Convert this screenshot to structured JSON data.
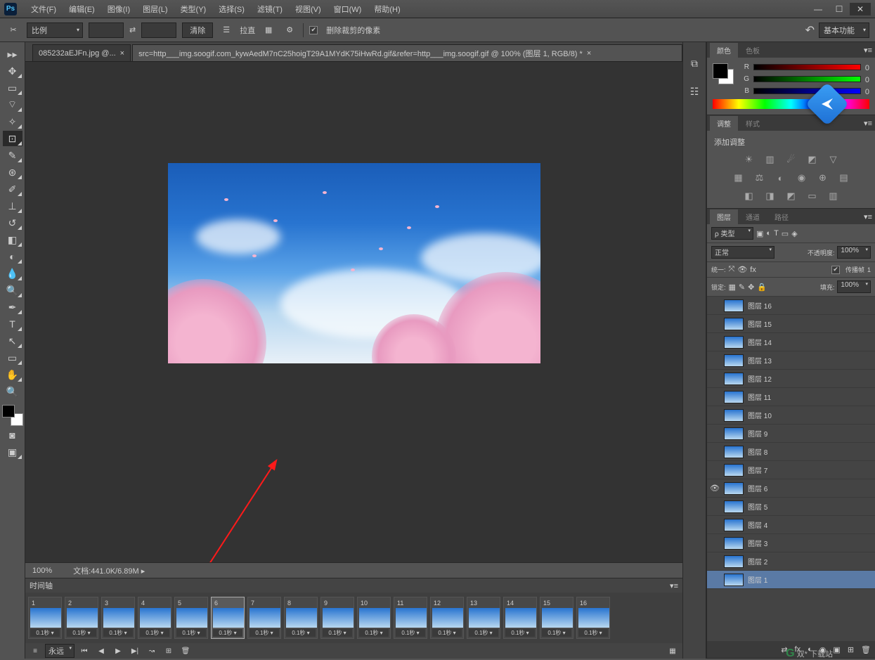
{
  "app": {
    "logo": "Ps"
  },
  "menu": {
    "file": "文件(F)",
    "edit": "编辑(E)",
    "image": "图像(I)",
    "layer": "图层(L)",
    "type": "类型(Y)",
    "select": "选择(S)",
    "filter": "滤镜(T)",
    "view": "视图(V)",
    "window": "窗口(W)",
    "help": "帮助(H)"
  },
  "window_controls": {
    "min": "—",
    "max": "☐",
    "close": "✕"
  },
  "options_bar": {
    "ratio_label": "比例",
    "clear": "清除",
    "straighten": "拉直",
    "delete_cropped": "删除裁剪的像素",
    "workspace": "基本功能"
  },
  "tabs": {
    "tab1": "085232aEJFn.jpg @...",
    "tab2": "src=http___img.soogif.com_kywAedM7nC25hoigT29A1MYdK75iHwRd.gif&refer=http___img.soogif.gif @ 100% (图层 1, RGB/8) *",
    "close": "×"
  },
  "status": {
    "zoom": "100%",
    "doc_label": "文档",
    "doc_info": ":441.0K/6.89M"
  },
  "timeline": {
    "title": "时间轴",
    "forever": "永远",
    "frames": [
      {
        "n": "1",
        "t": "0.1秒"
      },
      {
        "n": "2",
        "t": "0.1秒"
      },
      {
        "n": "3",
        "t": "0.1秒"
      },
      {
        "n": "4",
        "t": "0.1秒"
      },
      {
        "n": "5",
        "t": "0.1秒"
      },
      {
        "n": "6",
        "t": "0.1秒"
      },
      {
        "n": "7",
        "t": "0.1秒"
      },
      {
        "n": "8",
        "t": "0.1秒"
      },
      {
        "n": "9",
        "t": "0.1秒"
      },
      {
        "n": "10",
        "t": "0.1秒"
      },
      {
        "n": "11",
        "t": "0.1秒"
      },
      {
        "n": "12",
        "t": "0.1秒"
      },
      {
        "n": "13",
        "t": "0.1秒"
      },
      {
        "n": "14",
        "t": "0.1秒"
      },
      {
        "n": "15",
        "t": "0.1秒"
      },
      {
        "n": "16",
        "t": "0.1秒"
      }
    ],
    "selected": 6
  },
  "color_panel": {
    "tab1": "颜色",
    "tab2": "色板",
    "r": "R",
    "g": "G",
    "b": "B",
    "r_val": "0",
    "g_val": "0",
    "b_val": "0"
  },
  "adjust_panel": {
    "tab1": "调整",
    "tab2": "样式",
    "add": "添加调整"
  },
  "layers_panel": {
    "tab1": "图层",
    "tab2": "通道",
    "tab3": "路径",
    "kind": "ρ 类型",
    "blend": "正常",
    "opacity_label": "不透明度:",
    "opacity_val": "100%",
    "unify": "统一:",
    "propagate": "传播帧",
    "propagate_val": "1",
    "lock": "锁定:",
    "fill_label": "填充:",
    "fill_val": "100%",
    "layers": [
      {
        "name": "图层 16"
      },
      {
        "name": "图层 15"
      },
      {
        "name": "图层 14"
      },
      {
        "name": "图层 13"
      },
      {
        "name": "图层 12"
      },
      {
        "name": "图层 11"
      },
      {
        "name": "图层 10"
      },
      {
        "name": "图层 9"
      },
      {
        "name": "图层 8"
      },
      {
        "name": "图层 7"
      },
      {
        "name": "图层 6"
      },
      {
        "name": "图层 5"
      },
      {
        "name": "图层 4"
      },
      {
        "name": "图层 3"
      },
      {
        "name": "图层 2"
      },
      {
        "name": "图层 1"
      }
    ],
    "visible_idx": 10,
    "selected_idx": 15
  },
  "watermark": "双* 下载站"
}
